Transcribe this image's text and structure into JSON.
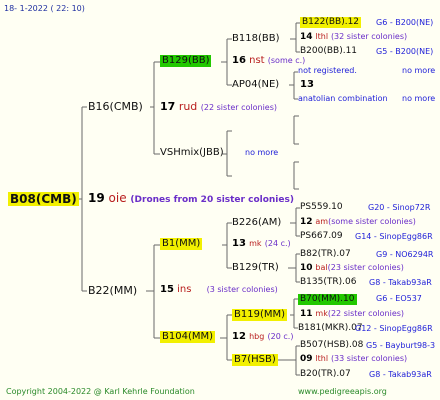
{
  "header": "18-   1-2022 (  22:  10)",
  "footer": {
    "copyright": "Copyright 2004-2022 @ Karl Kehrle Foundation",
    "site": "www.pedigreeapis.org"
  },
  "root": {
    "label": "B08(CMB)",
    "number": "19",
    "race": "oie",
    "note": "(Drones from 20 sister colonies)"
  },
  "nodes": {
    "b16": "B16(CMB)",
    "b16_num": "17",
    "b16_race": "rud",
    "b16_sis": "(22 sister colonies)",
    "b129": "B129(BB)",
    "b129_num": "16",
    "b129_race": "nst",
    "b129_sis": "(some c.)",
    "b118": "B118(BB)",
    "ap04": "AP04(NE)",
    "vshmix": "VSHmix(JBB)",
    "vshmix_note": "no more",
    "b122": "B122(BB).12",
    "b122_ref": "G6 - B200(NE)",
    "b122_num": "14",
    "b122_race": "lthl",
    "b122_sis": "(32 sister colonies)",
    "b200": "B200(BB).11",
    "b200_ref": "G5 - B200(NE)",
    "notreg": "not registered.",
    "notreg_note": "no more",
    "ap_num": "13",
    "anatolian": "anatolian combination",
    "anatolian_note": "no more",
    "b22": "B22(MM)",
    "b22_num": "15",
    "b22_race": "ins",
    "b22_sis": "(3 sister colonies)",
    "b1": "B1(MM)",
    "b1_num": "13",
    "b1_race": "mk",
    "b1_sis": "(24 c.)",
    "b226": "B226(AM)",
    "ps559": "PS559.10",
    "ps559_ref": "G20 - Sinop72R",
    "b226_num": "12",
    "b226_race": "am",
    "b226_sis": "(some sister colonies)",
    "ps667": "PS667.09",
    "ps667_ref": "G14 - SinopEgg86R",
    "b129tr": "B129(TR)",
    "b82": "B82(TR).07",
    "b82_ref": "G9 - NO6294R",
    "b129tr_num": "10",
    "b129tr_race": "bal",
    "b129tr_sis": "(23 sister colonies)",
    "b135": "B135(TR).06",
    "b135_ref": "G8 - Takab93aR",
    "b104": "B104(MM)",
    "b104_num": "12",
    "b104_race": "hbg",
    "b104_sis": "(20 c.)",
    "b119": "B119(MM)",
    "b70": "B70(MM).10",
    "b70_ref": "G6 - EO537",
    "b119_num": "11",
    "b119_race": "mk",
    "b119_sis": "(22 sister colonies)",
    "b181": "B181(MKR).07",
    "b181_ref": "G12 - SinopEgg86R",
    "b7": "B7(HSB)",
    "b507": "B507(HSB).08",
    "b507_ref": "G5 - Bayburt98-3",
    "b7_num": "09",
    "b7_race": "lthl",
    "b7_sis": "(33 sister colonies)",
    "b20": "B20(TR).07",
    "b20_ref": "G8 - Takab93aR"
  },
  "colors": {
    "highlight_yellow": "#f2f000",
    "highlight_green": "#22c800",
    "line": "#5a5a5a"
  }
}
